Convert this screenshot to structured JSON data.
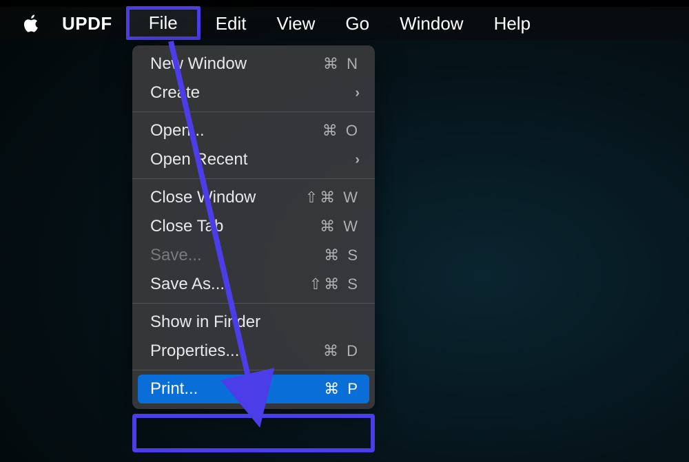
{
  "menubar": {
    "app_name": "UPDF",
    "items": {
      "file": "File",
      "edit": "Edit",
      "view": "View",
      "go": "Go",
      "window": "Window",
      "help": "Help"
    }
  },
  "dropdown": {
    "new_window": {
      "label": "New Window",
      "shortcut": "⌘ N"
    },
    "create": {
      "label": "Create"
    },
    "open": {
      "label": "Open...",
      "shortcut": "⌘ O"
    },
    "open_recent": {
      "label": "Open Recent"
    },
    "close_window": {
      "label": "Close Window",
      "shortcut": "⇧⌘ W"
    },
    "close_tab": {
      "label": "Close Tab",
      "shortcut": "⌘ W"
    },
    "save": {
      "label": "Save...",
      "shortcut": "⌘ S"
    },
    "save_as": {
      "label": "Save As...",
      "shortcut": "⇧⌘ S"
    },
    "show_in_finder": {
      "label": "Show in Finder"
    },
    "properties": {
      "label": "Properties...",
      "shortcut": "⌘ D"
    },
    "print": {
      "label": "Print...",
      "shortcut": "⌘ P"
    }
  }
}
